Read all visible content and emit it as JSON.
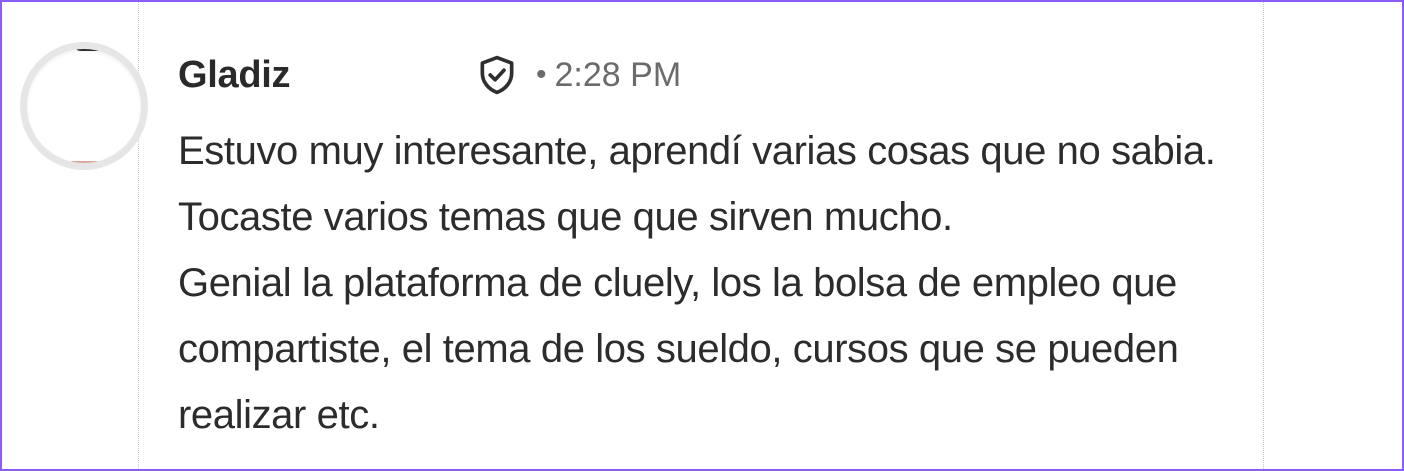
{
  "comment": {
    "author": "Gladiz",
    "badge_icon": "shield-check-icon",
    "separator": "•",
    "time": "2:28 PM",
    "lines": [
      "Estuvo muy interesante, aprendí varias cosas que no sabia.",
      "Tocaste varios temas que que sirven mucho.",
      "Genial la plataforma de cluely, los la bolsa de empleo que",
      "compartiste, el tema de los sueldo, cursos que se pueden",
      "realizar etc."
    ]
  },
  "colors": {
    "border": "#8b5cf6",
    "text": "#2c2c2c",
    "meta": "#6b6b6b"
  }
}
